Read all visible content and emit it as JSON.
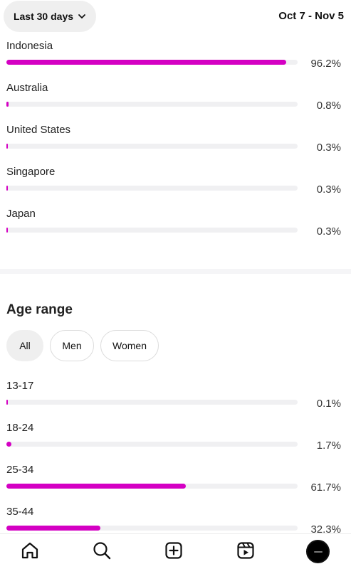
{
  "header": {
    "range_label": "Last 30 days",
    "date_range": "Oct 7 - Nov 5"
  },
  "locations": [
    {
      "label": "Indonesia",
      "percent_text": "96.2%",
      "value": 96.2
    },
    {
      "label": "Australia",
      "percent_text": "0.8%",
      "value": 0.8
    },
    {
      "label": "United States",
      "percent_text": "0.3%",
      "value": 0.3
    },
    {
      "label": "Singapore",
      "percent_text": "0.3%",
      "value": 0.3
    },
    {
      "label": "Japan",
      "percent_text": "0.3%",
      "value": 0.3
    }
  ],
  "age_section": {
    "title": "Age range",
    "filters": [
      {
        "label": "All",
        "selected": true
      },
      {
        "label": "Men",
        "selected": false
      },
      {
        "label": "Women",
        "selected": false
      }
    ],
    "rows": [
      {
        "label": "13-17",
        "percent_text": "0.1%",
        "value": 0.1
      },
      {
        "label": "18-24",
        "percent_text": "1.7%",
        "value": 1.7
      },
      {
        "label": "25-34",
        "percent_text": "61.7%",
        "value": 61.7
      },
      {
        "label": "35-44",
        "percent_text": "32.3%",
        "value": 32.3
      }
    ]
  },
  "nav": {
    "items": [
      "home-icon",
      "search-icon",
      "create-icon",
      "reels-icon",
      "profile-avatar"
    ]
  },
  "colors": {
    "bar_fill": "#d400c3",
    "bar_track": "#f0f0f2"
  }
}
